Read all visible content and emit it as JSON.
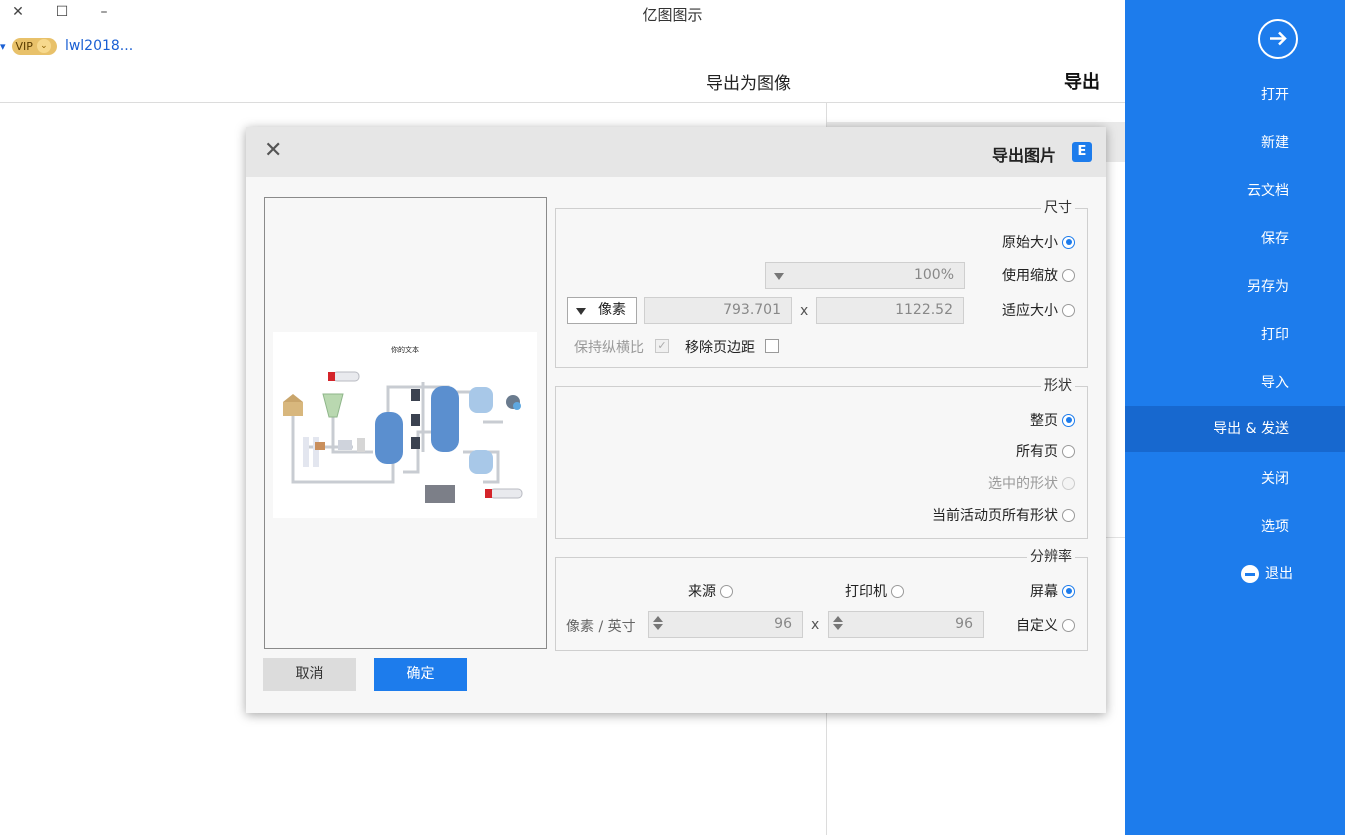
{
  "window": {
    "title": "亿图图示",
    "close_glyph": "✕",
    "maximize_glyph": "☐",
    "minimize_glyph": "–"
  },
  "user": {
    "vip_label": "VIP",
    "name": "lwl2018...",
    "dropdown_glyph": "▾"
  },
  "panel": {
    "heading": "导出",
    "subheading": "导出为图像"
  },
  "sidebar": {
    "back_glyph": "→",
    "items": [
      {
        "label": "打开"
      },
      {
        "label": "新建"
      },
      {
        "label": "云文档"
      },
      {
        "label": "保存"
      },
      {
        "label": "另存为"
      },
      {
        "label": "打印"
      },
      {
        "label": "导入"
      },
      {
        "label": "导出 & 发送"
      },
      {
        "label": "关闭"
      },
      {
        "label": "选项"
      },
      {
        "label": "退出"
      }
    ],
    "active_item": "导出 & 发送",
    "accent": "#1d7cec"
  },
  "dialog": {
    "title": "导出图片",
    "logo_glyph": "E",
    "close_glyph": "✕",
    "preview": {
      "diagram_title": "你的文本"
    },
    "size": {
      "legend": "尺寸",
      "options": [
        "原始大小",
        "使用缩放",
        "适应大小"
      ],
      "selected": "原始大小",
      "zoom_value": "100%",
      "width_value": "1122.52",
      "height_value": "793.701",
      "unit_value": "像素",
      "times": "x",
      "remove_margin_label": "移除页边距",
      "keep_ratio_label": "保持纵横比",
      "keep_ratio_check": "✓"
    },
    "shape": {
      "legend": "形状",
      "options": [
        "整页",
        "所有页",
        "选中的形状",
        "当前活动页所有形状"
      ],
      "selected": "整页",
      "disabled": "选中的形状"
    },
    "resolution": {
      "legend": "分辨率",
      "options": [
        "屏幕",
        "打印机",
        "来源",
        "自定义"
      ],
      "selected": "屏幕",
      "dpi_x": "96",
      "dpi_y": "96",
      "times": "x",
      "unit": "像素 / 英寸"
    },
    "ok_label": "确定",
    "cancel_label": "取消"
  }
}
